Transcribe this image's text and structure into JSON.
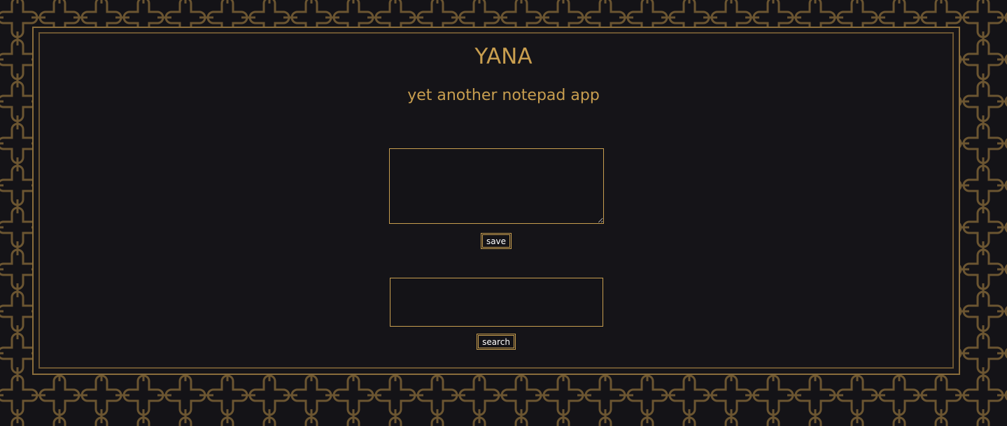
{
  "app": {
    "title": "YANA",
    "subtitle": "yet another notepad app"
  },
  "note": {
    "value": "",
    "placeholder": ""
  },
  "save": {
    "label": "save"
  },
  "search": {
    "value": "",
    "placeholder": "",
    "button_label": "search"
  },
  "colors": {
    "background": "#141317",
    "accent": "#c89e4f",
    "pattern": "#6b5531",
    "button_text": "#ffffff"
  }
}
